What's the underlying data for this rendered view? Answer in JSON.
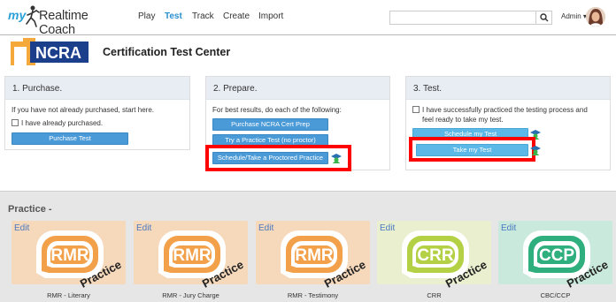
{
  "app": {
    "logo_prefix": "my",
    "logo_brand": "Realtime Coach"
  },
  "nav": {
    "items": [
      "Play",
      "Test",
      "Track",
      "Create",
      "Import"
    ],
    "active": "Test"
  },
  "search": {
    "placeholder": "",
    "value": ""
  },
  "user": {
    "name": "Admin"
  },
  "header": {
    "logo_text": "NCRA",
    "title": "Certification Test Center"
  },
  "panels": {
    "purchase": {
      "heading": "1. Purchase.",
      "text": "If you have not already purchased, start here.",
      "checkbox_label": "I have already purchased.",
      "button": "Purchase Test"
    },
    "prepare": {
      "heading": "2. Prepare.",
      "text": "For best results, do each of the following:",
      "buttons": [
        "Purchase NCRA Cert Prep",
        "Try a Practice Test (no proctor)",
        "Schedule/Take a Proctored Practice"
      ]
    },
    "test": {
      "heading": "3. Test.",
      "checkbox_label_line1": "I have successfully practiced the testing process and",
      "checkbox_label_line2": "feel ready to take my test.",
      "buttons": [
        "Schedule my Test",
        "Take my Test"
      ]
    }
  },
  "practice": {
    "title": "Practice -",
    "cards": [
      {
        "edit": "Edit",
        "badge": "RMR",
        "overlay": "Practice",
        "caption": "RMR - Literary",
        "bg": "#f6d8bb",
        "ring": "#f2a04a"
      },
      {
        "edit": "Edit",
        "badge": "RMR",
        "overlay": "Practice",
        "caption": "RMR - Jury Charge",
        "bg": "#f6d8bb",
        "ring": "#f2a04a"
      },
      {
        "edit": "Edit",
        "badge": "RMR",
        "overlay": "Practice",
        "caption": "RMR - Testimony",
        "bg": "#f6d8bb",
        "ring": "#f2a04a"
      },
      {
        "edit": "Edit",
        "badge": "CRR",
        "overlay": "Practice",
        "caption": "CRR",
        "bg": "#e9efcf",
        "ring": "#b4d045"
      },
      {
        "edit": "Edit",
        "badge": "CCP",
        "overlay": "Practice",
        "caption": "CBC/CCP",
        "bg": "#c9e9dc",
        "ring": "#2fae7e"
      }
    ]
  },
  "icons": {
    "search": "search-icon",
    "avatar": "user-avatar",
    "proctor": "graduate-icon"
  },
  "colors": {
    "accent": "#2a8fcf",
    "button": "#4a9ad8",
    "highlight": "#ff0000"
  }
}
